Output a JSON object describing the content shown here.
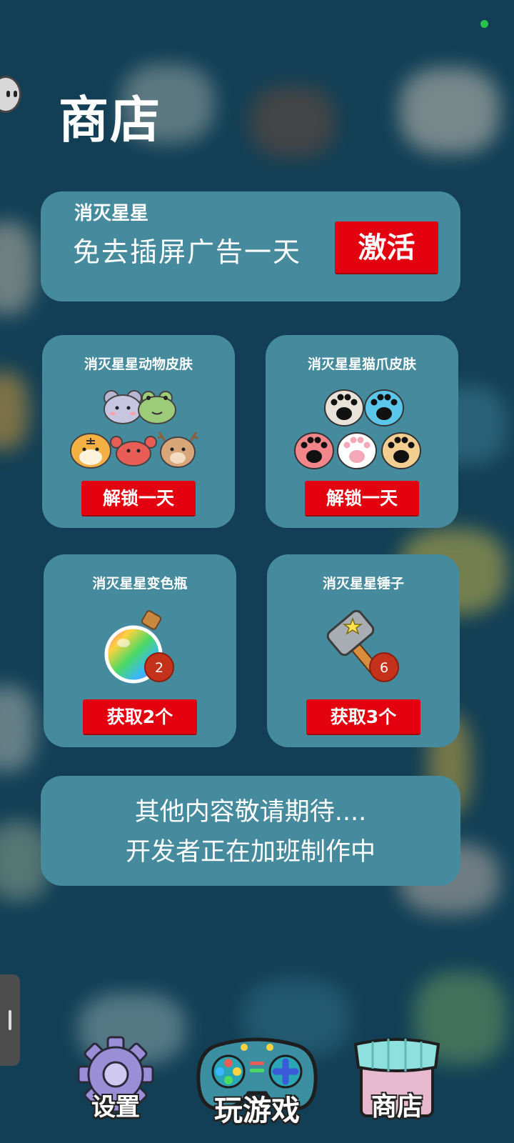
{
  "page": {
    "title": "商店"
  },
  "ad_card": {
    "subtitle": "消灭星星",
    "text": "免去插屏广告一天",
    "button_label": "激活"
  },
  "tiles": [
    {
      "title": "消灭星星动物皮肤",
      "button_label": "解锁一天"
    },
    {
      "title": "消灭星星猫爪皮肤",
      "button_label": "解锁一天"
    },
    {
      "title": "消灭星星变色瓶",
      "badge": "2",
      "button_label": "获取2个"
    },
    {
      "title": "消灭星星锤子",
      "badge": "6",
      "button_label": "获取3个"
    }
  ],
  "info_card": {
    "line1": "其他内容敬请期待....",
    "line2": "开发者正在加班制作中"
  },
  "bottom_nav": [
    {
      "label": "设置",
      "icon": "gear-icon"
    },
    {
      "label": "玩游戏",
      "icon": "gamepad-icon"
    },
    {
      "label": "商店",
      "icon": "shop-icon"
    }
  ],
  "colors": {
    "card": "#458b9d",
    "button": "#e3000f",
    "background": "#123f55",
    "status_dot": "#27c24c"
  }
}
